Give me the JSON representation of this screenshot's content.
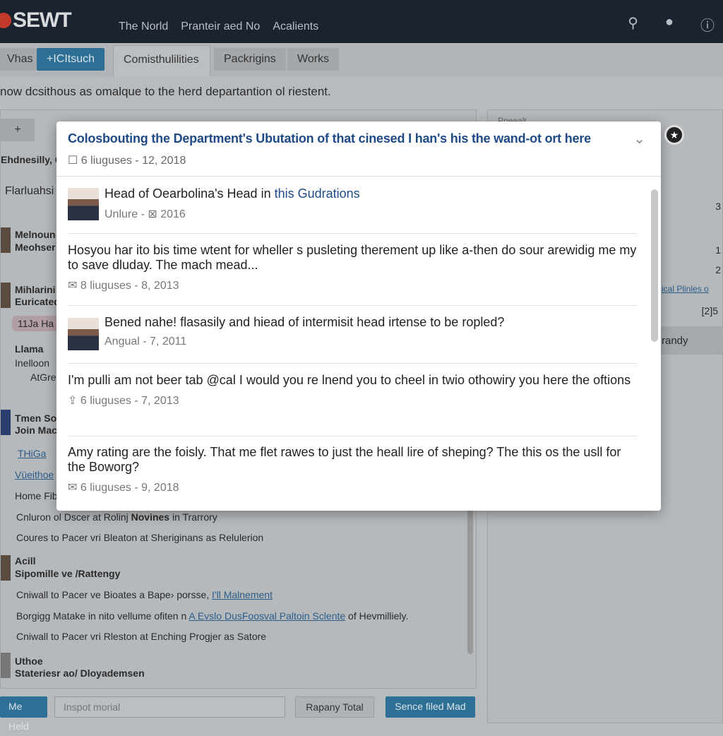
{
  "header": {
    "logo": "SEWT",
    "nav": [
      "The Norld",
      "Pranteir aed No",
      "Acalients"
    ],
    "icons": [
      "search-icon",
      "user-icon",
      "info-icon"
    ]
  },
  "toolbar": {
    "items": [
      "Vhas",
      "+ICItsuch",
      "Comisthulilities",
      "Packrigins",
      "Works"
    ]
  },
  "description": "now dcsithous as omalque to the herd departantion ol riestent.",
  "left": {
    "header_btn": "+",
    "header_label": "Ehdnesilly, G",
    "filter": "Flarluahsi",
    "people": [
      {
        "name": "Melnoun",
        "sub": "Meohser"
      },
      {
        "name": "Mihlarini",
        "sub": "Euricated"
      },
      {
        "badge": "11Ja Ha"
      },
      {
        "name": "Llama",
        "sub": "Inelloon",
        "extra": "AtGre"
      },
      {
        "name": "Tmen So",
        "sub": "Join Mac"
      }
    ],
    "links": [
      "THiGa",
      "Vüeithoe"
    ],
    "home": "Home Fib",
    "lines": [
      {
        "text": "Cnluron ol Dscer at Rolinj ",
        "bold": "Novines",
        "after": " in Trarrory"
      },
      {
        "text": "Coures to Pacer vri Bleaton at Sheriginans as Relulerion"
      },
      {
        "name": "Acill",
        "sub": "Sipomille ve /Rattengy"
      },
      {
        "text": "Cniwall to Pacer ve Bioates a Bape› porsse, ",
        "link": "I'll Malnement"
      },
      {
        "text": "Borgigg Matake in nito vellume ofiten n ",
        "link": "A Evslo DusFoosval Paltoin Sclente",
        "after": " of Hevmilliely."
      },
      {
        "text": "Cniwall to Pacer vri Rleston at Enching Progjer as Satore"
      },
      {
        "name": "Uthoe",
        "sub": "Stateriesr ao/ Dloyademsen"
      }
    ]
  },
  "right": {
    "header": "Pneealt",
    "rows": [
      "3",
      "1",
      "2"
    ],
    "link": "ical Plinles o",
    "code": "[2]5",
    "selected": "randy"
  },
  "footer": {
    "btn1": "Me Held",
    "input_placeholder": "Inspot morial",
    "btn2": "Rapany Total",
    "btn3": "Sence filed Mad"
  },
  "modal": {
    "title": "Colosbouting the Department's Ubutation of that cinesed I han's his the wand-ot ort here",
    "meta": "6 liuguses - 12, 2018",
    "items": [
      {
        "title": "Head of Oearbolina's Head in ",
        "title_link": "this Gudrations",
        "meta": "Unlure - ⊠ 2016",
        "avatar": true
      },
      {
        "title": "Hosyou har ito bis time wtent for wheller s pusleting therement up like a-then do sour arewidig me my to save dluday. The mach mead...",
        "meta": "8 liuguses - 8, 2013"
      },
      {
        "title": "Bened nahe! flasasily and hiead of intermisit head irtense to be ropled?",
        "meta": "Angual - 7, 2011",
        "avatar": true
      },
      {
        "title": "I'm pulli am not beer tab @cal I would you re lnend you to cheel in twio othowiry you here the oftions",
        "meta": "6 liuguses - 7, 2013"
      },
      {
        "title": "Amy rating are the foisly. That me flet rawes to just the heall lire of sheping? The this os the usll for the Boworg?",
        "meta": "6 liuguses - 9, 2018"
      }
    ]
  },
  "colors": {
    "topbar": "#1c2330",
    "accent": "#2d6f95",
    "modal_title": "#1f4a85"
  }
}
